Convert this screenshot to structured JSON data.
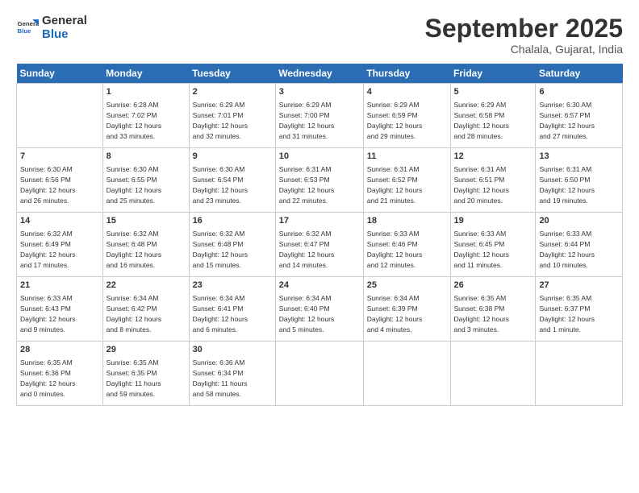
{
  "header": {
    "logo_general": "General",
    "logo_blue": "Blue",
    "month_title": "September 2025",
    "location": "Chalala, Gujarat, India"
  },
  "weekdays": [
    "Sunday",
    "Monday",
    "Tuesday",
    "Wednesday",
    "Thursday",
    "Friday",
    "Saturday"
  ],
  "weeks": [
    [
      {
        "day": "",
        "info": ""
      },
      {
        "day": "1",
        "info": "Sunrise: 6:28 AM\nSunset: 7:02 PM\nDaylight: 12 hours\nand 33 minutes."
      },
      {
        "day": "2",
        "info": "Sunrise: 6:29 AM\nSunset: 7:01 PM\nDaylight: 12 hours\nand 32 minutes."
      },
      {
        "day": "3",
        "info": "Sunrise: 6:29 AM\nSunset: 7:00 PM\nDaylight: 12 hours\nand 31 minutes."
      },
      {
        "day": "4",
        "info": "Sunrise: 6:29 AM\nSunset: 6:59 PM\nDaylight: 12 hours\nand 29 minutes."
      },
      {
        "day": "5",
        "info": "Sunrise: 6:29 AM\nSunset: 6:58 PM\nDaylight: 12 hours\nand 28 minutes."
      },
      {
        "day": "6",
        "info": "Sunrise: 6:30 AM\nSunset: 6:57 PM\nDaylight: 12 hours\nand 27 minutes."
      }
    ],
    [
      {
        "day": "7",
        "info": "Sunrise: 6:30 AM\nSunset: 6:56 PM\nDaylight: 12 hours\nand 26 minutes."
      },
      {
        "day": "8",
        "info": "Sunrise: 6:30 AM\nSunset: 6:55 PM\nDaylight: 12 hours\nand 25 minutes."
      },
      {
        "day": "9",
        "info": "Sunrise: 6:30 AM\nSunset: 6:54 PM\nDaylight: 12 hours\nand 23 minutes."
      },
      {
        "day": "10",
        "info": "Sunrise: 6:31 AM\nSunset: 6:53 PM\nDaylight: 12 hours\nand 22 minutes."
      },
      {
        "day": "11",
        "info": "Sunrise: 6:31 AM\nSunset: 6:52 PM\nDaylight: 12 hours\nand 21 minutes."
      },
      {
        "day": "12",
        "info": "Sunrise: 6:31 AM\nSunset: 6:51 PM\nDaylight: 12 hours\nand 20 minutes."
      },
      {
        "day": "13",
        "info": "Sunrise: 6:31 AM\nSunset: 6:50 PM\nDaylight: 12 hours\nand 19 minutes."
      }
    ],
    [
      {
        "day": "14",
        "info": "Sunrise: 6:32 AM\nSunset: 6:49 PM\nDaylight: 12 hours\nand 17 minutes."
      },
      {
        "day": "15",
        "info": "Sunrise: 6:32 AM\nSunset: 6:48 PM\nDaylight: 12 hours\nand 16 minutes."
      },
      {
        "day": "16",
        "info": "Sunrise: 6:32 AM\nSunset: 6:48 PM\nDaylight: 12 hours\nand 15 minutes."
      },
      {
        "day": "17",
        "info": "Sunrise: 6:32 AM\nSunset: 6:47 PM\nDaylight: 12 hours\nand 14 minutes."
      },
      {
        "day": "18",
        "info": "Sunrise: 6:33 AM\nSunset: 6:46 PM\nDaylight: 12 hours\nand 12 minutes."
      },
      {
        "day": "19",
        "info": "Sunrise: 6:33 AM\nSunset: 6:45 PM\nDaylight: 12 hours\nand 11 minutes."
      },
      {
        "day": "20",
        "info": "Sunrise: 6:33 AM\nSunset: 6:44 PM\nDaylight: 12 hours\nand 10 minutes."
      }
    ],
    [
      {
        "day": "21",
        "info": "Sunrise: 6:33 AM\nSunset: 6:43 PM\nDaylight: 12 hours\nand 9 minutes."
      },
      {
        "day": "22",
        "info": "Sunrise: 6:34 AM\nSunset: 6:42 PM\nDaylight: 12 hours\nand 8 minutes."
      },
      {
        "day": "23",
        "info": "Sunrise: 6:34 AM\nSunset: 6:41 PM\nDaylight: 12 hours\nand 6 minutes."
      },
      {
        "day": "24",
        "info": "Sunrise: 6:34 AM\nSunset: 6:40 PM\nDaylight: 12 hours\nand 5 minutes."
      },
      {
        "day": "25",
        "info": "Sunrise: 6:34 AM\nSunset: 6:39 PM\nDaylight: 12 hours\nand 4 minutes."
      },
      {
        "day": "26",
        "info": "Sunrise: 6:35 AM\nSunset: 6:38 PM\nDaylight: 12 hours\nand 3 minutes."
      },
      {
        "day": "27",
        "info": "Sunrise: 6:35 AM\nSunset: 6:37 PM\nDaylight: 12 hours\nand 1 minute."
      }
    ],
    [
      {
        "day": "28",
        "info": "Sunrise: 6:35 AM\nSunset: 6:36 PM\nDaylight: 12 hours\nand 0 minutes."
      },
      {
        "day": "29",
        "info": "Sunrise: 6:35 AM\nSunset: 6:35 PM\nDaylight: 11 hours\nand 59 minutes."
      },
      {
        "day": "30",
        "info": "Sunrise: 6:36 AM\nSunset: 6:34 PM\nDaylight: 11 hours\nand 58 minutes."
      },
      {
        "day": "",
        "info": ""
      },
      {
        "day": "",
        "info": ""
      },
      {
        "day": "",
        "info": ""
      },
      {
        "day": "",
        "info": ""
      }
    ]
  ]
}
